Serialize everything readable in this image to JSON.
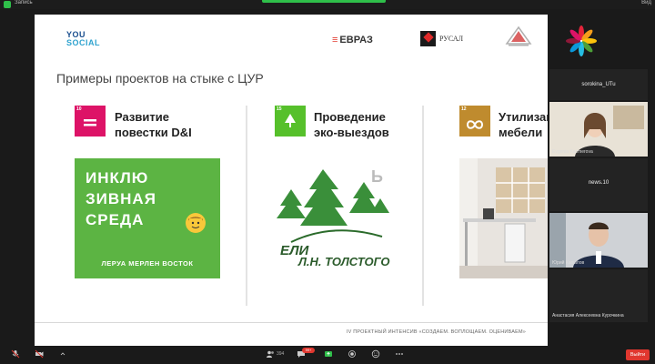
{
  "topbar": {
    "user_name": "Запись",
    "view_label": "Вид"
  },
  "slide": {
    "logos": {
      "you_line1": "YOU",
      "you_line2": "SOCIAL",
      "evraz_mark": "≡",
      "evraz": "ЕВРАЗ",
      "rusal": "РУСАЛ"
    },
    "title": "Примеры проектов на стыке с ЦУР",
    "columns": [
      {
        "sdg_number": "10",
        "sdg_color": "#dd1367",
        "label_line1": "Развитие",
        "label_line2": "повестки D&I"
      },
      {
        "sdg_number": "15",
        "sdg_color": "#56c02b",
        "label_line1": "Проведение",
        "label_line2": "эко-выездов"
      },
      {
        "sdg_number": "12",
        "sdg_color": "#bf8b2e",
        "label_line1": "Утилизац",
        "label_line2": "мебели"
      }
    ],
    "inclusive": {
      "line1": "ИНКЛЮ",
      "line2": "ЗИВНАЯ",
      "line3": "СРЕДА",
      "caption": "ЛЕРУА МЕРЛЕН ВОСТОК"
    },
    "trees_logo": {
      "letter": "Ь",
      "line1": "ЕЛИ",
      "line2": "Л.Н. ТОЛСТОГО"
    },
    "footer": "IV ПРОЕКТНЫЙ ИНТЕНСИВ «СОЗДАЕМ. ВОПЛОЩАЕМ. ОЦЕНИВАЕМ»"
  },
  "participants": [
    {
      "name": "sorokina_UTu",
      "type": "name-only"
    },
    {
      "name": "Evgenia Kazmerova",
      "type": "video-woman"
    },
    {
      "name": "news.10",
      "type": "name-only"
    },
    {
      "name": "Юрий Капылов",
      "type": "video-man"
    },
    {
      "name": "Анастасия Алексеевна Курочкина",
      "type": "name-only"
    }
  ],
  "toolbar": {
    "participants_count": "394",
    "chat_badge": "99+",
    "exit_label": "Выйти"
  },
  "colors": {
    "accent_green": "#2fbf4a",
    "exit_red": "#e0372f",
    "inclusive_green": "#5cb443"
  }
}
